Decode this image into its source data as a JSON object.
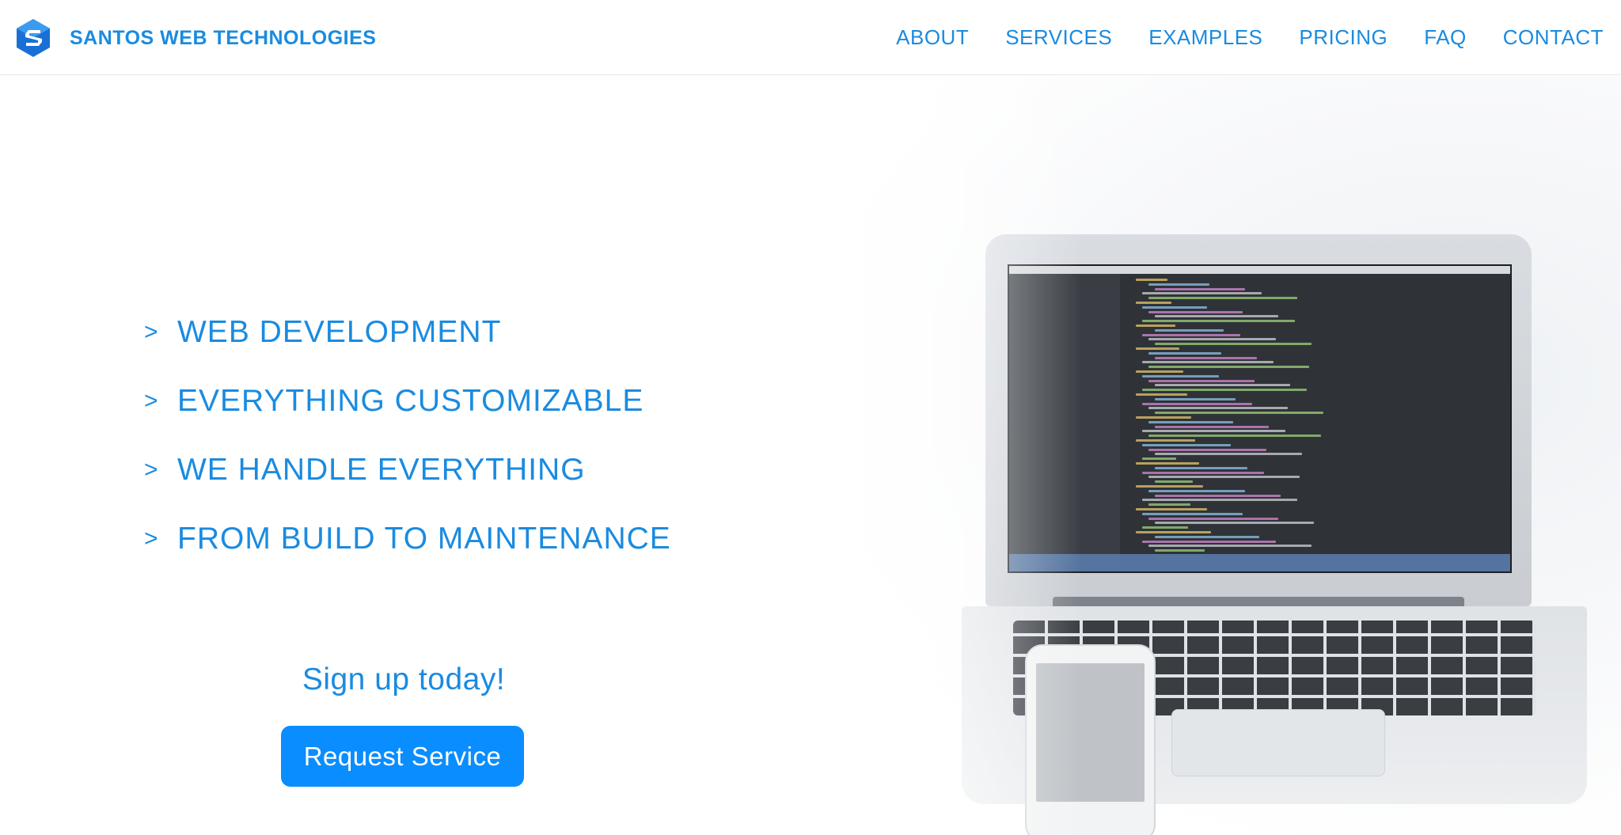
{
  "header": {
    "brand_name": "SANTOS WEB TECHNOLOGIES",
    "logo_icon": "s-hexagon-logo-icon",
    "nav": [
      {
        "label": "ABOUT"
      },
      {
        "label": "SERVICES"
      },
      {
        "label": "EXAMPLES"
      },
      {
        "label": "PRICING"
      },
      {
        "label": "FAQ"
      },
      {
        "label": "CONTACT"
      }
    ]
  },
  "hero": {
    "features": [
      {
        "arrow": ">",
        "text": "WEB DEVELOPMENT"
      },
      {
        "arrow": ">",
        "text": "EVERYTHING CUSTOMIZABLE"
      },
      {
        "arrow": ">",
        "text": "WE HANDLE EVERYTHING"
      },
      {
        "arrow": ">",
        "text": "FROM BUILD TO MAINTENANCE"
      }
    ],
    "cta_title": "Sign up today!",
    "cta_button": "Request Service",
    "image": "laptop-and-phone-photo"
  },
  "colors": {
    "accent": "#1a8be0",
    "button": "#0a8dff",
    "background": "#ffffff"
  }
}
